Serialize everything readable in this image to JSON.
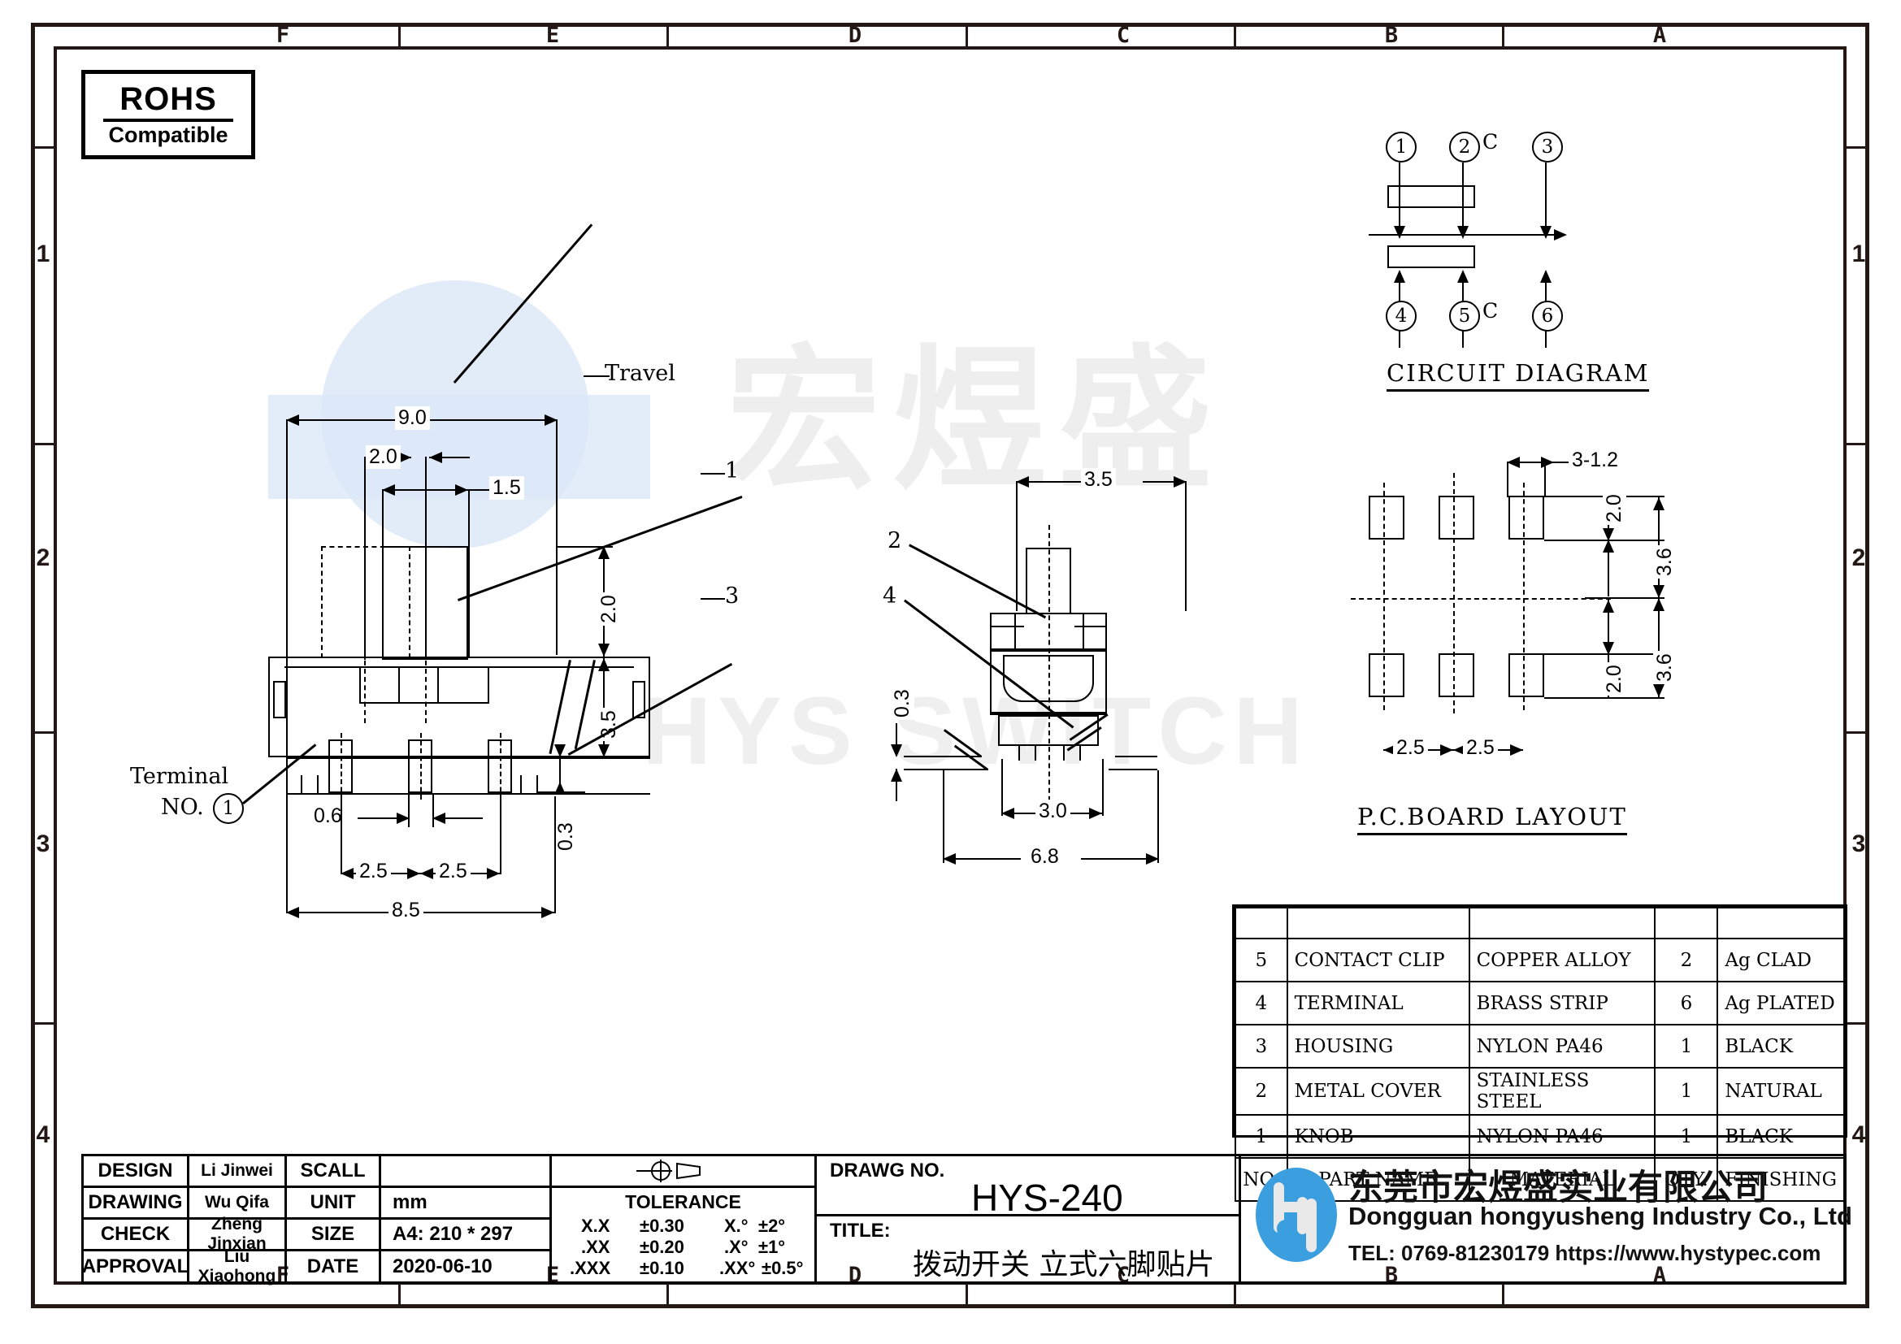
{
  "sheet": {
    "zones_top": [
      "F",
      "E",
      "D",
      "C",
      "B",
      "A"
    ],
    "zones_bottom": [
      "F",
      "E",
      "D",
      "C",
      "B",
      "A"
    ],
    "zones_left": [
      "1",
      "2",
      "3",
      "4"
    ],
    "zones_right": [
      "1",
      "2",
      "3",
      "4"
    ]
  },
  "rohs": {
    "line1": "ROHS",
    "line2": "Compatible"
  },
  "watermark": {
    "cjk": "宏煜盛",
    "latin": "HYS SWITCH"
  },
  "front_view": {
    "labels": {
      "travel": "Travel",
      "terminal_no_line1": "Terminal",
      "terminal_no_line2": "NO.",
      "terminal_no_circle": "1",
      "leader_1": "1",
      "leader_3": "3"
    },
    "dimensions": {
      "overall_width": "9.0",
      "travel_offset": "2.0",
      "knob_width": "1.5",
      "knob_height": "2.0",
      "body_height": "3.5",
      "terminal_thickness": "0.3",
      "terminal_width": "0.6",
      "pitch_left": "2.5",
      "pitch_right": "2.5",
      "base_width": "8.5"
    }
  },
  "side_view": {
    "labels": {
      "leader_2": "2",
      "leader_4": "4"
    },
    "dimensions": {
      "knob_span": "3.5",
      "inner_width": "3.0",
      "overall_width": "6.8",
      "terminal_thickness": "0.3"
    }
  },
  "circuit_diagram": {
    "caption": "CIRCUIT  DIAGRAM",
    "top_pins": [
      "1",
      "2",
      "3"
    ],
    "bottom_pins": [
      "4",
      "5",
      "6"
    ],
    "common_top": "C",
    "common_bottom": "C"
  },
  "pcb_layout": {
    "caption": "P.C.BOARD  LAYOUT",
    "dimensions": {
      "pad_callout": "3-1.2",
      "pad_height_top": "2.0",
      "pad_height_bottom": "2.0",
      "span_top": "3.6",
      "span_bottom": "3.6",
      "pitch_left": "2.5",
      "pitch_right": "2.5"
    }
  },
  "bom": {
    "header": {
      "no": "NO.",
      "part_name": "PART  NAME",
      "material": "MATERIAL",
      "qty": "QTY.",
      "finishing": "FINISHING"
    },
    "rows": [
      {
        "no": "5",
        "part_name": "CONTACT CLIP",
        "material": "COPPER ALLOY",
        "qty": "2",
        "finishing": "Ag CLAD"
      },
      {
        "no": "4",
        "part_name": "TERMINAL",
        "material": "BRASS STRIP",
        "qty": "6",
        "finishing": "Ag PLATED"
      },
      {
        "no": "3",
        "part_name": "HOUSING",
        "material": "NYLON PA46",
        "qty": "1",
        "finishing": "BLACK"
      },
      {
        "no": "2",
        "part_name": "METAL COVER",
        "material": "STAINLESS STEEL",
        "qty": "1",
        "finishing": "NATURAL"
      },
      {
        "no": "1",
        "part_name": "KNOB",
        "material": "NYLON PA46",
        "qty": "1",
        "finishing": "BLACK"
      }
    ]
  },
  "title_block": {
    "design_label": "DESIGN",
    "design_value": "Li Jinwei",
    "drawing_label": "DRAWING",
    "drawing_value": "Wu Qifa",
    "check_label": "CHECK",
    "check_value": "Zheng Jinxian",
    "approval_label": "APPROVAL",
    "approval_value": "Liu Xiaohong",
    "scall_label": "SCALL",
    "scall_value": "",
    "unit_label": "UNIT",
    "unit_value": "mm",
    "size_label": "SIZE",
    "size_value": "A4: 210 * 297",
    "date_label": "DATE",
    "date_value": "2020-06-10",
    "tolerance_title": "TOLERANCE",
    "tolerance_rows": [
      {
        "left_key": "X.X",
        "left_val": "±0.30",
        "right_key": "X.°",
        "right_val": "±2°"
      },
      {
        "left_key": ".XX",
        "left_val": "±0.20",
        "right_key": ".X°",
        "right_val": "±1°"
      },
      {
        "left_key": ".XXX",
        "left_val": "±0.10",
        "right_key": ".XX°",
        "right_val": "±0.5°"
      }
    ],
    "drawg_no_label": "DRAWG NO.",
    "drawg_no_value": "HYS-240",
    "title_label": "TITLE:",
    "title_value": "拨动开关 立式六脚贴片"
  },
  "company": {
    "name_cn": "东莞市宏煜盛实业有限公司",
    "name_en": "Dongguan hongyusheng Industry Co., Ltd",
    "contact": "TEL: 0769-81230179   https://www.hystypec.com",
    "logo_color": "#3b9ede"
  }
}
